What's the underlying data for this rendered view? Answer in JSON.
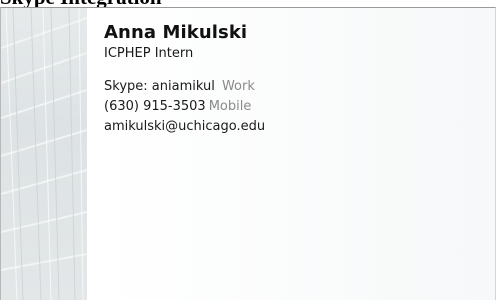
{
  "caption": "Skype Integration",
  "contact": {
    "name": "Anna Mikulski",
    "title": "ICPHEP Intern",
    "skype": {
      "label": "Skype:",
      "value": "aniamikul",
      "type": "Work"
    },
    "phone": {
      "value": "(630) 915-3503",
      "type": "Mobile"
    },
    "email": {
      "value": "amikulski@uchicago.edu"
    }
  },
  "colors": {
    "secondary_text": "#8a8a8a",
    "border": "#9a9a9a"
  }
}
